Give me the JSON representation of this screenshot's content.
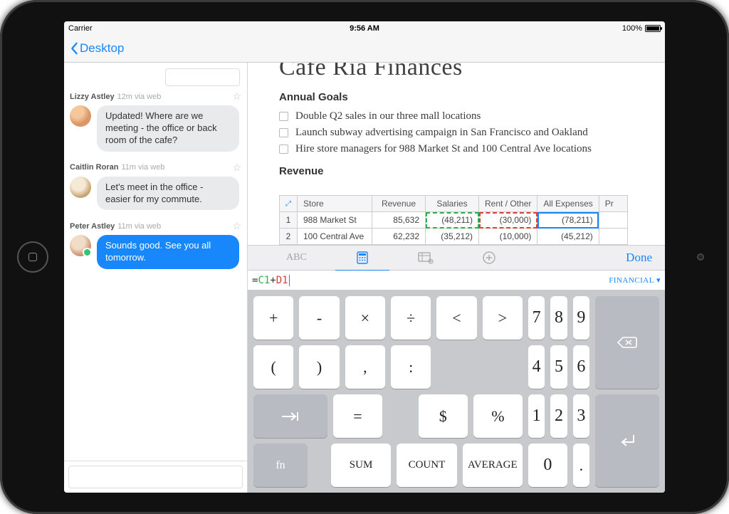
{
  "status": {
    "carrier": "Carrier",
    "time": "9:56 AM",
    "battery": "100%"
  },
  "nav": {
    "back_label": "Desktop"
  },
  "sidebar": {
    "messages": [
      {
        "name": "Lizzy Astley",
        "meta": "12m via web",
        "text": "Updated! Where are we meeting - the office or back room of the cafe?",
        "mine": false
      },
      {
        "name": "Caitlin Roran",
        "meta": "11m via web",
        "text": "Let's meet in the office - easier for my commute.",
        "mine": false
      },
      {
        "name": "Peter Astley",
        "meta": "11m via web",
        "text": "Sounds good. See you all tomorrow.",
        "mine": true
      }
    ]
  },
  "doc": {
    "title": "Cafe Ria Finances",
    "h_goals": "Annual Goals",
    "goals": [
      "Double Q2 sales in our three mall locations",
      "Launch subway advertising campaign in San Francisco and Oakland",
      "Hire store managers for 988 Market St and 100 Central Ave locations"
    ],
    "h_revenue": "Revenue"
  },
  "sheet": {
    "headers": [
      "Store",
      "Revenue",
      "Salaries",
      "Rent / Other",
      "All Expenses",
      "Pr"
    ],
    "rows": [
      {
        "n": "1",
        "store": "988 Market St",
        "rev": "85,632",
        "sal": "(48,211)",
        "rent": "(30,000)",
        "exp": "(78,211)"
      },
      {
        "n": "2",
        "store": "100 Central Ave",
        "rev": "62,232",
        "sal": "(35,212)",
        "rent": "(10,000)",
        "exp": "(45,212)"
      }
    ]
  },
  "formula_tabs": {
    "abc": "ABC",
    "done": "Done"
  },
  "formula": {
    "eq": "=",
    "c1": "C1",
    "plus": "+",
    "d1": "D1",
    "fin": "FINANCIAL"
  },
  "keys": {
    "plus": "+",
    "minus": "-",
    "mult": "×",
    "div": "÷",
    "lt": "<",
    "gt": ">",
    "lp": "(",
    "rp": ")",
    "comma": ",",
    "colon": ":",
    "eq": "=",
    "dollar": "$",
    "pct": "%",
    "fn": "fn",
    "sum": "SUM",
    "count": "COUNT",
    "avg": "AVERAGE",
    "n7": "7",
    "n8": "8",
    "n9": "9",
    "n4": "4",
    "n5": "5",
    "n6": "6",
    "n1": "1",
    "n2": "2",
    "n3": "3",
    "n0": "0",
    "dot": "."
  }
}
